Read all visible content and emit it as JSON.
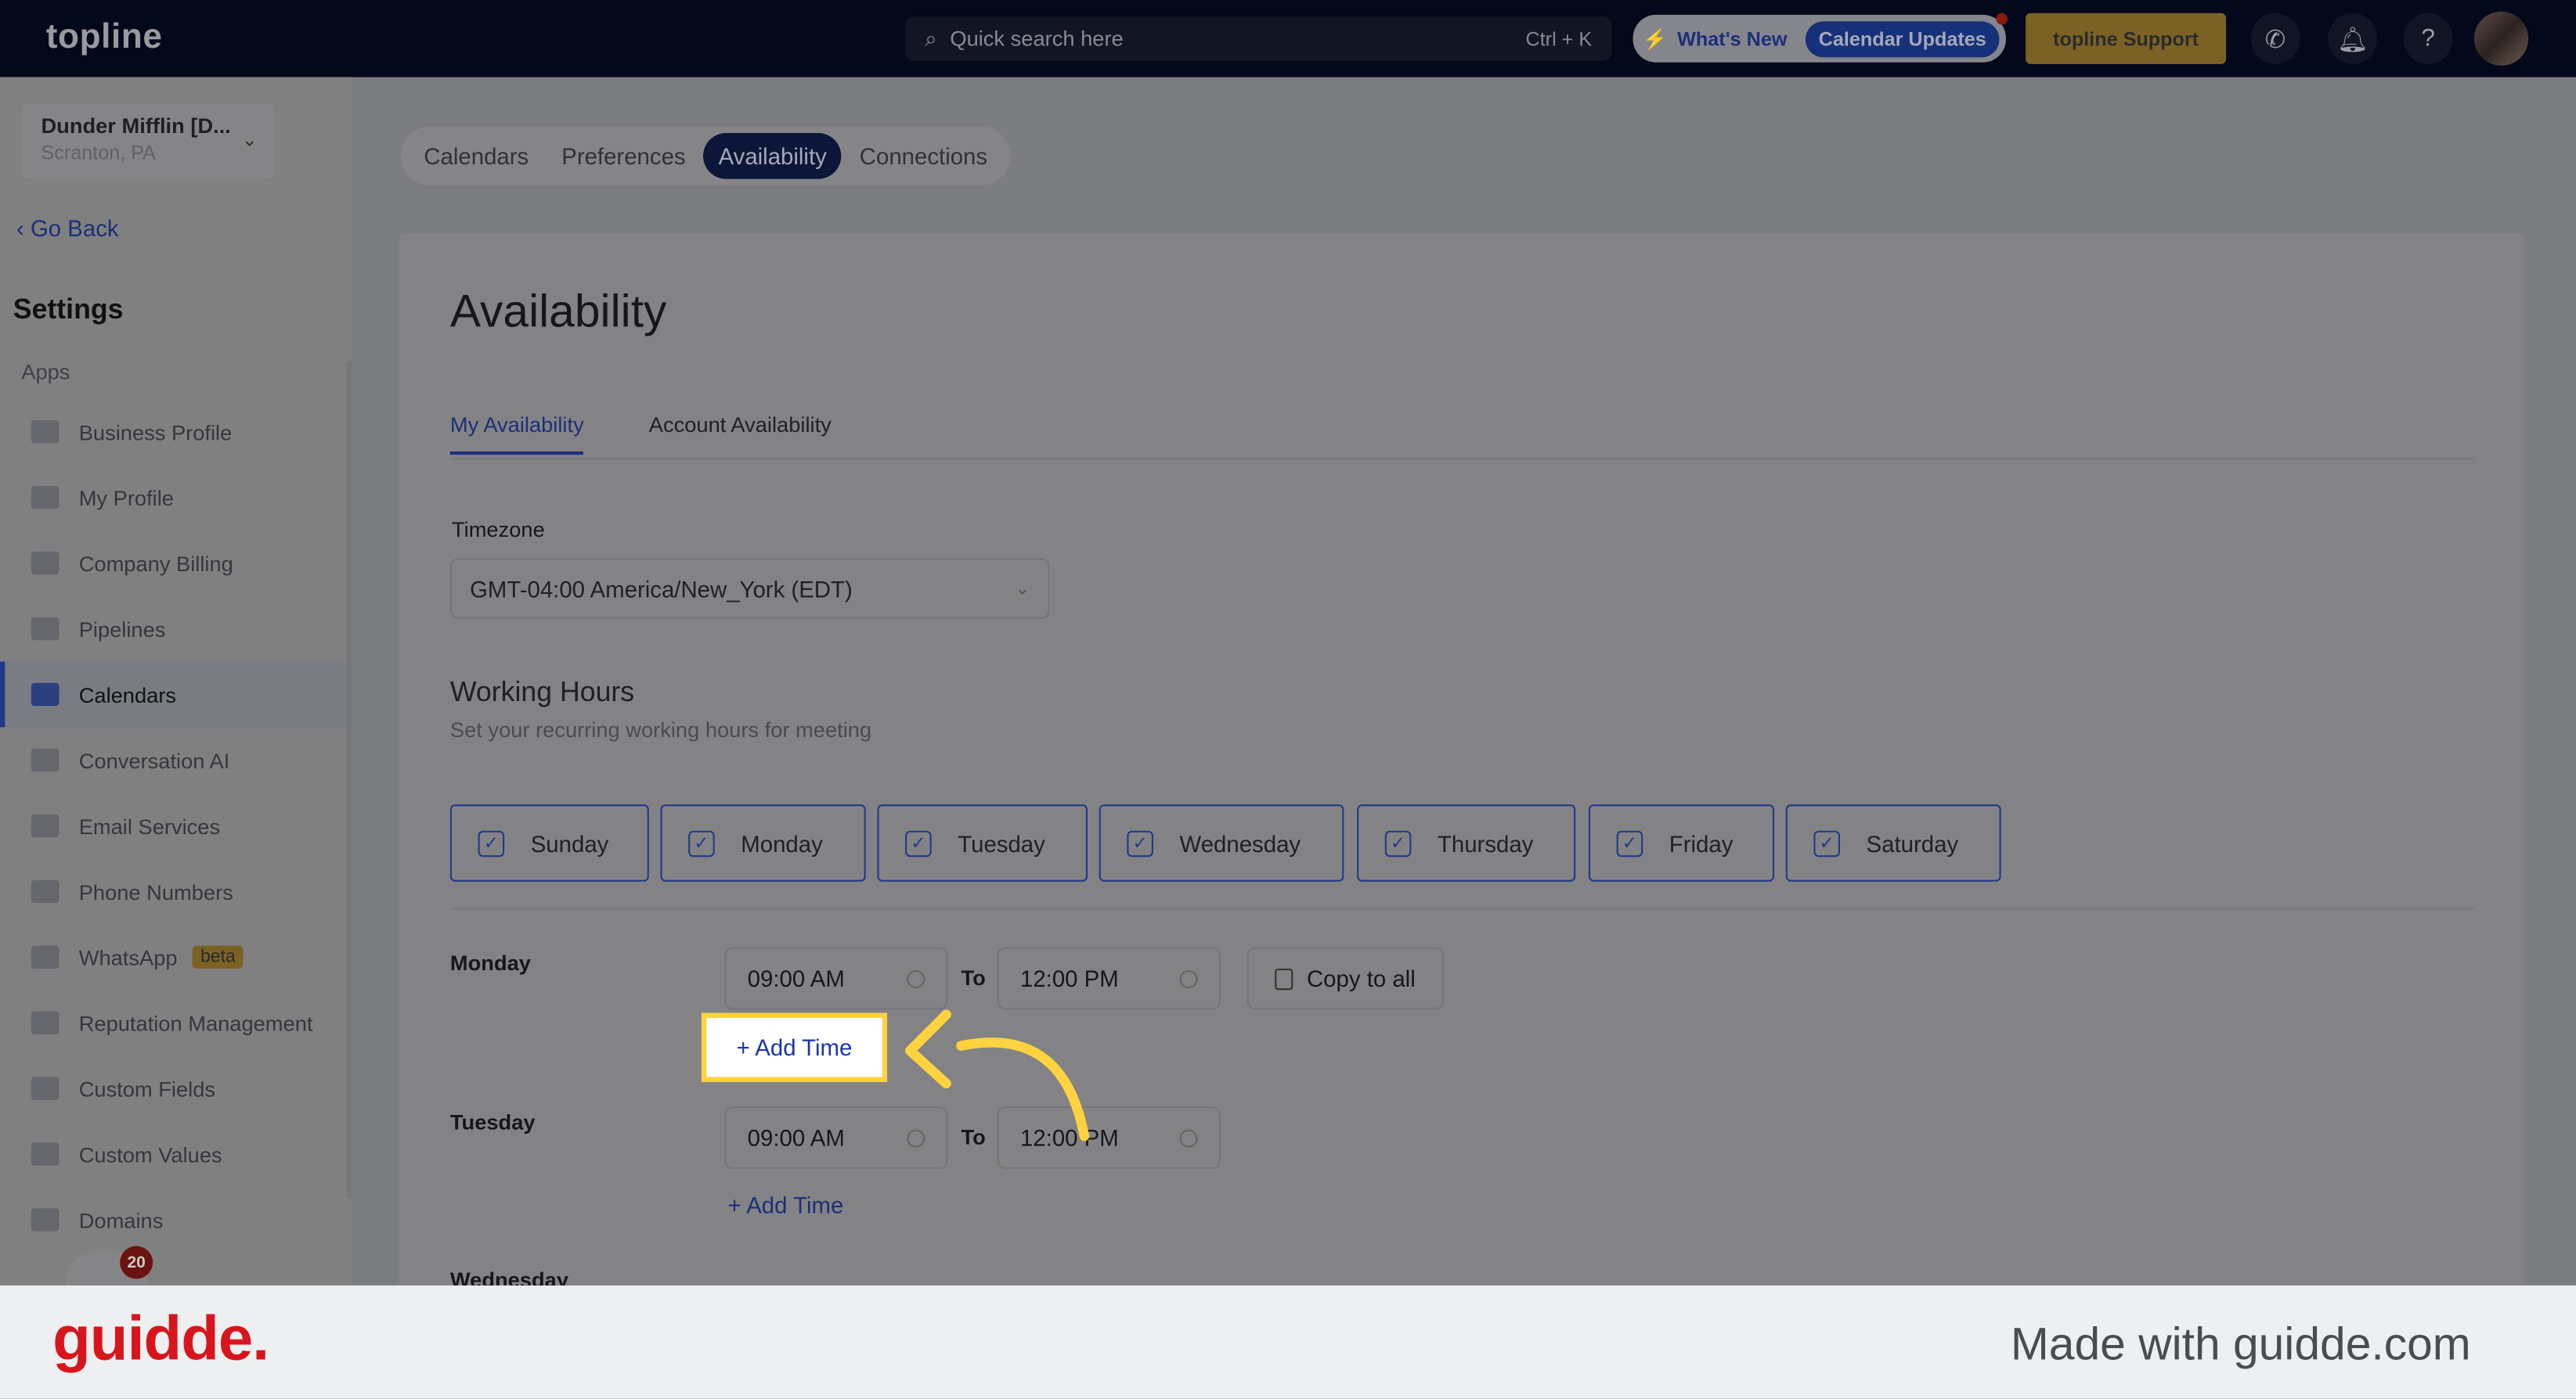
{
  "topbar": {
    "logo": "topline",
    "search_placeholder": "Quick search here",
    "search_shortcut": "Ctrl + K",
    "whats_new": "What's New",
    "calendar_updates": "Calendar Updates",
    "support": "topline Support"
  },
  "account": {
    "name": "Dunder Mifflin [D...",
    "location": "Scranton, PA"
  },
  "sidebar": {
    "back": "Go Back",
    "heading": "Settings",
    "section": "Apps",
    "items": [
      {
        "label": "Business Profile",
        "icon": "briefcase-icon"
      },
      {
        "label": "My Profile",
        "icon": "user-icon"
      },
      {
        "label": "Company Billing",
        "icon": "billing-icon"
      },
      {
        "label": "Pipelines",
        "icon": "pipeline-icon"
      },
      {
        "label": "Calendars",
        "icon": "calendar-icon",
        "active": true
      },
      {
        "label": "Conversation AI",
        "icon": "chat-icon"
      },
      {
        "label": "Email Services",
        "icon": "email-icon"
      },
      {
        "label": "Phone Numbers",
        "icon": "phone-icon"
      },
      {
        "label": "WhatsApp",
        "icon": "whatsapp-icon",
        "badge": "beta"
      },
      {
        "label": "Reputation Management",
        "icon": "star-icon"
      },
      {
        "label": "Custom Fields",
        "icon": "edit-icon"
      },
      {
        "label": "Custom Values",
        "icon": "pie-icon"
      },
      {
        "label": "Domains",
        "icon": "domain-icon"
      }
    ],
    "notification_count": "20"
  },
  "tabs": [
    "Calendars",
    "Preferences",
    "Availability",
    "Connections"
  ],
  "main": {
    "title": "Availability",
    "subtabs": [
      "My Availability",
      "Account Availability"
    ],
    "timezone_label": "Timezone",
    "timezone": "GMT-04:00 America/New_York (EDT)",
    "working_hours": "Working Hours",
    "working_hours_sub": "Set your recurring working hours for meeting",
    "days": [
      "Sunday",
      "Monday",
      "Tuesday",
      "Wednesday",
      "Thursday",
      "Friday",
      "Saturday"
    ],
    "schedule": [
      {
        "day": "Monday",
        "from": "09:00 AM",
        "to": "12:00 PM"
      },
      {
        "day": "Tuesday",
        "from": "09:00 AM",
        "to": "12:00 PM"
      },
      {
        "day": "Wednesday"
      }
    ],
    "to_label": "To",
    "copy_all": "Copy to all",
    "add_time": "+ Add Time"
  },
  "footer": {
    "logo": "guidde.",
    "made_with": "Made with guidde.com"
  },
  "colors": {
    "highlight": "#ffd23f",
    "accent": "#1a33b5",
    "brand_red": "#d8151d"
  }
}
